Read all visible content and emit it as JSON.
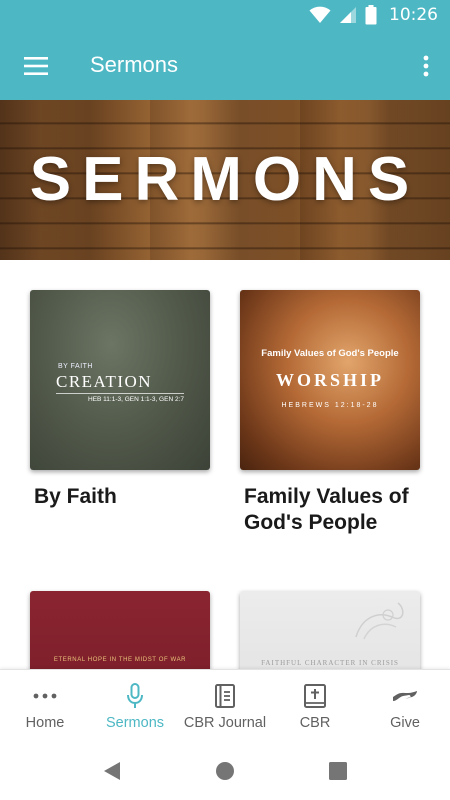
{
  "status_bar": {
    "time": "10:26"
  },
  "app_bar": {
    "title": "Sermons",
    "menu_icon": "hamburger-menu-icon",
    "overflow_icon": "more-vertical-icon"
  },
  "banner": {
    "title": "SERMONS"
  },
  "sermons": [
    {
      "title": "By Faith",
      "art": {
        "small": "BY FAITH",
        "main": "CREATION",
        "refs": "HEB 11:1-3, GEN 1:1-3, GEN 2:7"
      }
    },
    {
      "title": "Family Values of God's People",
      "art": {
        "subtitle": "Family Values of God's People",
        "main": "WORSHIP",
        "ref": "HEBREWS 12:18-28"
      }
    },
    {
      "title": "",
      "art": {
        "text": "ETERNAL HOPE IN THE MIDST OF WAR"
      }
    },
    {
      "title": "",
      "art": {
        "text": "FAITHFUL CHARACTER IN CRISIS"
      }
    }
  ],
  "bottom_nav": {
    "items": [
      {
        "label": "Home",
        "icon": "more-horizontal-icon"
      },
      {
        "label": "Sermons",
        "icon": "microphone-icon",
        "active": true
      },
      {
        "label": "CBR Journal",
        "icon": "journal-icon"
      },
      {
        "label": "CBR",
        "icon": "bible-icon"
      },
      {
        "label": "Give",
        "icon": "give-hand-icon"
      }
    ]
  },
  "colors": {
    "primary": "#4db8c4",
    "nav_inactive": "#616161",
    "text": "#1a1a1a"
  }
}
